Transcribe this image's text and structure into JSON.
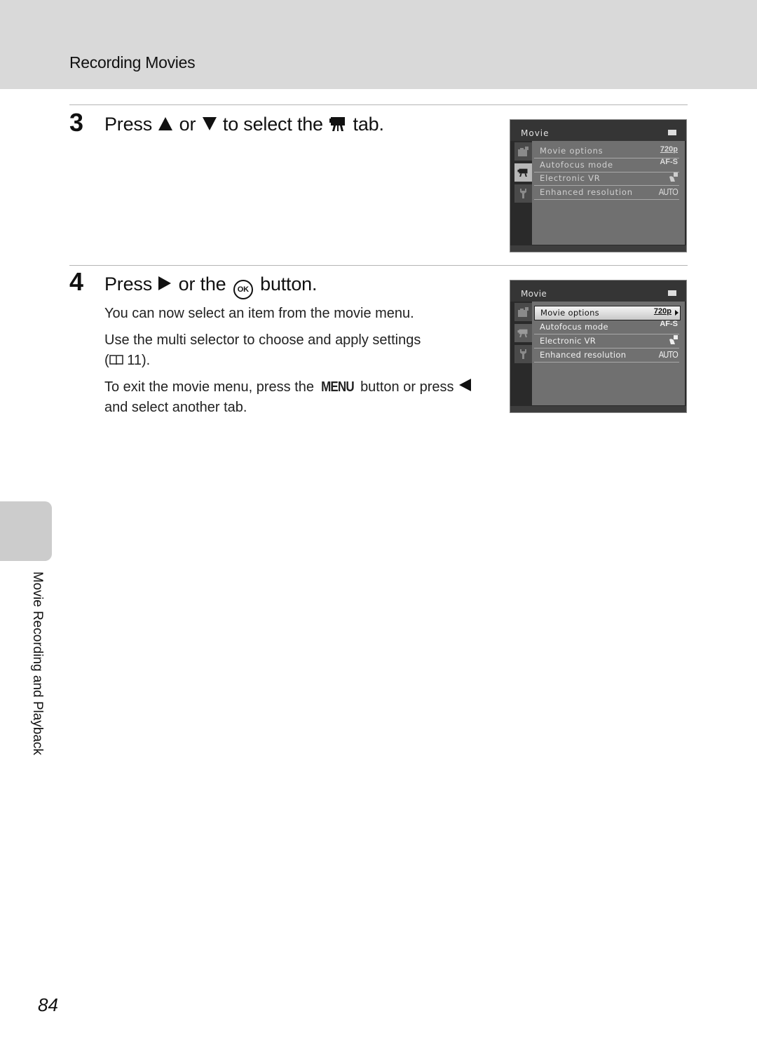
{
  "header": {
    "section_title": "Recording Movies"
  },
  "steps": [
    {
      "number": "3",
      "heading": {
        "press": "Press",
        "or": "or",
        "to_select_the": "to select the",
        "tab": "tab."
      },
      "icons": [
        "up-arrow-icon",
        "down-arrow-icon",
        "movie-tab-icon"
      ]
    },
    {
      "number": "4",
      "heading": {
        "press": "Press",
        "or_the": "or the",
        "button": "button.",
        "ok_label": "OK"
      },
      "icons": [
        "right-arrow-icon",
        "ok-button-icon"
      ],
      "paragraphs": {
        "p1": "You can now select an item from the movie menu.",
        "p2_text": "Use the multi selector to choose and apply settings",
        "p2_ref_open": "(",
        "p2_ref_page": "11).",
        "p3_start": "To exit the movie menu, press the",
        "p3_menu": "MENU",
        "p3_mid": "button or press",
        "p3_end": "and select another tab."
      }
    }
  ],
  "screens": [
    {
      "title": "Movie",
      "active_tab": "movie",
      "tabs": [
        "shooting-tab",
        "movie-tab",
        "setup-tab"
      ],
      "items": [
        {
          "label": "Movie options",
          "value": "720p",
          "icon": "hd-720p-icon"
        },
        {
          "label": "Autofocus mode",
          "value": "AF-S",
          "icon": "af-s-icon"
        },
        {
          "label": "Electronic VR",
          "value": "",
          "icon": "vr-hand-icon"
        },
        {
          "label": "Enhanced resolution",
          "value": "AUTO",
          "icon": ""
        }
      ],
      "selected_index": -1
    },
    {
      "title": "Movie",
      "active_tab": "movie",
      "tabs": [
        "shooting-tab",
        "movie-tab",
        "setup-tab"
      ],
      "items": [
        {
          "label": "Movie options",
          "value": "720p",
          "icon": "hd-720p-icon"
        },
        {
          "label": "Autofocus mode",
          "value": "AF-S",
          "icon": "af-s-icon"
        },
        {
          "label": "Electronic VR",
          "value": "",
          "icon": "vr-hand-icon"
        },
        {
          "label": "Enhanced resolution",
          "value": "AUTO",
          "icon": ""
        }
      ],
      "selected_index": 0
    }
  ],
  "side_tab": {
    "label": "Movie Recording and Playback"
  },
  "footer": {
    "page_number": "84"
  }
}
